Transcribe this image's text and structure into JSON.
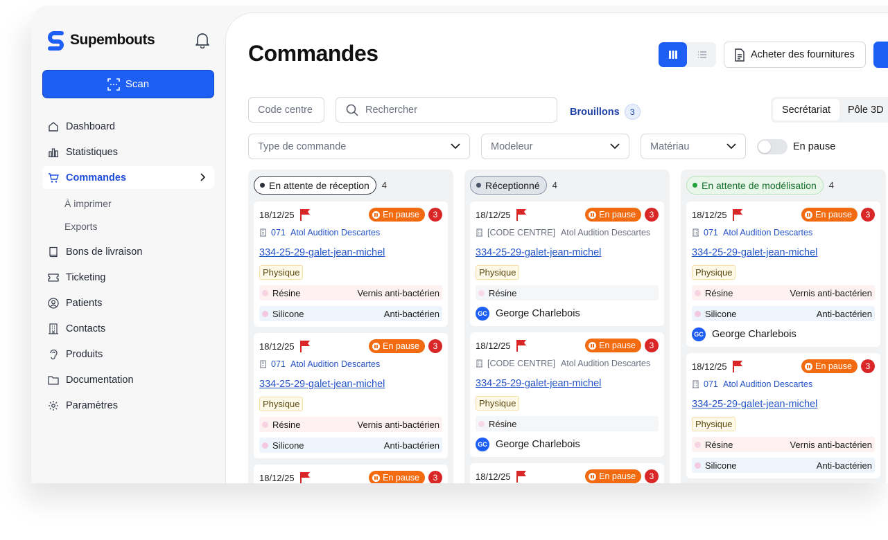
{
  "brand": {
    "name": "Supembouts",
    "logo_icon": "s-logo-icon",
    "accent": "#1d5ef5"
  },
  "sidebar": {
    "scan_label": "Scan",
    "items": [
      {
        "label": "Dashboard",
        "icon": "home-icon"
      },
      {
        "label": "Statistiques",
        "icon": "chart-icon"
      },
      {
        "label": "Commandes",
        "icon": "cart-icon",
        "active": true
      },
      {
        "label": "À imprimer",
        "sub": true
      },
      {
        "label": "Exports",
        "sub": true
      },
      {
        "label": "Bons de livraison",
        "icon": "book-icon"
      },
      {
        "label": "Ticketing",
        "icon": "ticket-icon"
      },
      {
        "label": "Patients",
        "icon": "user-circle-icon"
      },
      {
        "label": "Contacts",
        "icon": "building-icon"
      },
      {
        "label": "Produits",
        "icon": "ear-icon"
      },
      {
        "label": "Documentation",
        "icon": "folder-icon"
      },
      {
        "label": "Paramètres",
        "icon": "gear-icon"
      }
    ]
  },
  "header": {
    "title": "Commandes",
    "buy_label": "Acheter des fournitures"
  },
  "filters": {
    "code_centre_placeholder": "Code centre",
    "search_placeholder": "Rechercher",
    "drafts_label": "Brouillons",
    "drafts_count": "3",
    "segments": [
      "Secrétariat",
      "Pôle 3D"
    ],
    "type_placeholder": "Type de commande",
    "modeleur_placeholder": "Modeleur",
    "materiau_placeholder": "Matériau",
    "pause_toggle_label": "En pause"
  },
  "columns": [
    {
      "title": "En attente de réception",
      "count": "4",
      "cards": [
        {
          "date": "18/12/25",
          "status": "En pause",
          "count": "3",
          "centre_code": "071",
          "centre_name": "Atol Audition Descartes",
          "ref": "334-25-29-galet-jean-michel",
          "type": "Physique",
          "mat1_label": "Résine",
          "mat1_value": "Vernis anti-bactérien",
          "mat2_label": "Silicone",
          "mat2_value": "Anti-bactérien"
        },
        {
          "date": "18/12/25",
          "status": "En pause",
          "count": "3",
          "centre_code": "071",
          "centre_name": "Atol Audition Descartes",
          "ref": "334-25-29-galet-jean-michel",
          "type": "Physique",
          "mat1_label": "Résine",
          "mat1_value": "Vernis anti-bactérien",
          "mat2_label": "Silicone",
          "mat2_value": "Anti-bactérien"
        },
        {
          "date": "18/12/25",
          "status": "En pause",
          "count": "3"
        }
      ]
    },
    {
      "title": "Réceptionné",
      "count": "4",
      "cards": [
        {
          "date": "18/12/25",
          "status": "En pause",
          "count": "3",
          "centre_code": "[CODE CENTRE]",
          "centre_name": "Atol Audition Descartes",
          "ref": "334-25-29-galet-jean-michel",
          "type": "Physique",
          "mat1_label": "Résine",
          "user_initials": "GC",
          "user_name": "George Charlebois"
        },
        {
          "date": "18/12/25",
          "status": "En pause",
          "count": "3",
          "centre_code": "[CODE CENTRE]",
          "centre_name": "Atol Audition Descartes",
          "ref": "334-25-29-galet-jean-michel",
          "type": "Physique",
          "mat1_label": "Résine",
          "user_initials": "GC",
          "user_name": "George Charlebois"
        },
        {
          "date": "18/12/25",
          "status": "En pause",
          "count": "3"
        }
      ]
    },
    {
      "title": "En attente de modélisation",
      "count": "4",
      "cards": [
        {
          "date": "18/12/25",
          "status": "En pause",
          "count": "3",
          "centre_code": "071",
          "centre_name": "Atol Audition Descartes",
          "ref": "334-25-29-galet-jean-michel",
          "type": "Physique",
          "mat1_label": "Résine",
          "mat1_value": "Vernis anti-bactérien",
          "mat2_label": "Silicone",
          "mat2_value": "Anti-bactérien",
          "user_initials": "GC",
          "user_name": "George Charlebois"
        },
        {
          "date": "18/12/25",
          "status": "En pause",
          "count": "3",
          "centre_code": "071",
          "centre_name": "Atol Audition Descartes",
          "ref": "334-25-29-galet-jean-michel",
          "type": "Physique",
          "mat1_label": "Résine",
          "mat1_value": "Vernis anti-bactérien",
          "mat2_label": "Silicone",
          "mat2_value": "Anti-bactérien"
        }
      ]
    }
  ]
}
